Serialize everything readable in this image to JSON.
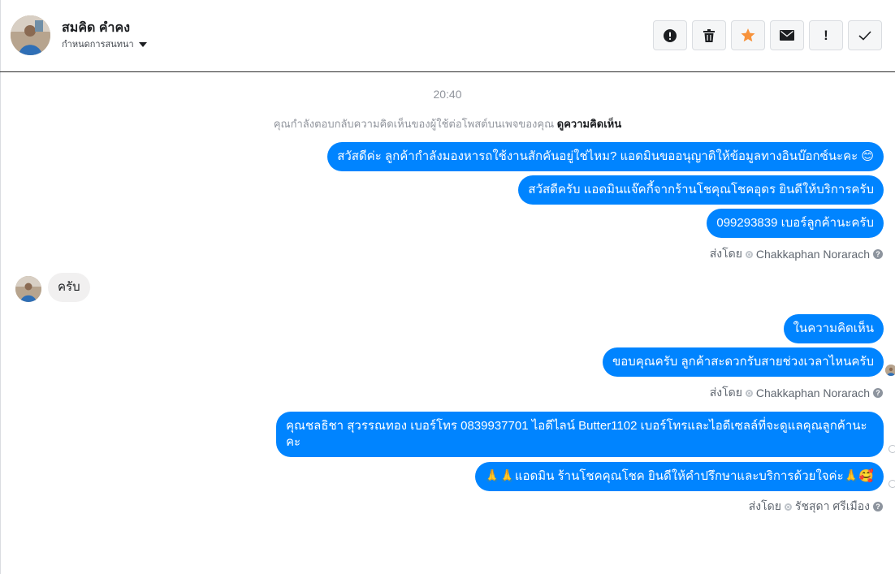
{
  "header": {
    "contact_name": "สมคิด คำคง",
    "assign_label": "กำหนดการสนทนา",
    "actions": [
      {
        "name": "spam-button",
        "icon": "alert-circle-icon"
      },
      {
        "name": "delete-button",
        "icon": "trash-icon"
      },
      {
        "name": "star-button",
        "icon": "star-icon"
      },
      {
        "name": "mark-unread-button",
        "icon": "envelope-icon"
      },
      {
        "name": "important-button",
        "icon": "exclamation-icon",
        "label": "!"
      },
      {
        "name": "mark-done-button",
        "icon": "checkmark-icon"
      }
    ]
  },
  "conversation": {
    "timestamp": "20:40",
    "notice_text": "คุณกำลังตอบกลับความคิดเห็นของผู้ใช้ต่อโพสต์บนเพจของคุณ",
    "notice_link": "ดูความคิดเห็น",
    "messages": [
      {
        "text": "สวัสดีค่ะ ลูกค้ากำลังมองหารถใช้งานสักคันอยู่ใช่ไหม? แอดมินขออนุญาติให้ข้อมูลทางอินบ๊อกซ์นะคะ 😊"
      },
      {
        "text": "สวัสดีครับ แอดมินแจ๊คกี้จากร้านโชคุณโชคอุดร ยินดีให้บริการครับ"
      },
      {
        "text": "099293839 เบอร์ลูกค้านะครับ"
      },
      {
        "text": "ครับ"
      },
      {
        "text": "ในความคิดเห็น"
      },
      {
        "text": "ขอบคุณครับ ลูกค้าสะดวกรับสายช่วงเวลาไหนครับ"
      },
      {
        "text": "คุณชลธิชา สุวรรณทอง   เบอร์โทร 0839937701  ไอดีไลน์ Butter1102   เบอร์โทรและไอดีเซลล์ที่จะดูแลคุณลูกค้านะคะ"
      },
      {
        "text": "🙏🙏แอดมิน ร้านโชคคุณโชค ยินดีให้คำปรึกษาและบริการด้วยใจค่ะ🙏🥰"
      }
    ],
    "sent_by": [
      {
        "prefix": "ส่งโดย",
        "name": "Chakkaphan Norarach"
      },
      {
        "prefix": "ส่งโดย",
        "name": "Chakkaphan Norarach"
      },
      {
        "prefix": "ส่งโดย",
        "name": "รัชสุดา ศรีเมือง"
      }
    ]
  },
  "colors": {
    "outgoing_bubble": "#0084ff",
    "incoming_bubble": "#f1f0f0",
    "star": "#f7923b"
  }
}
